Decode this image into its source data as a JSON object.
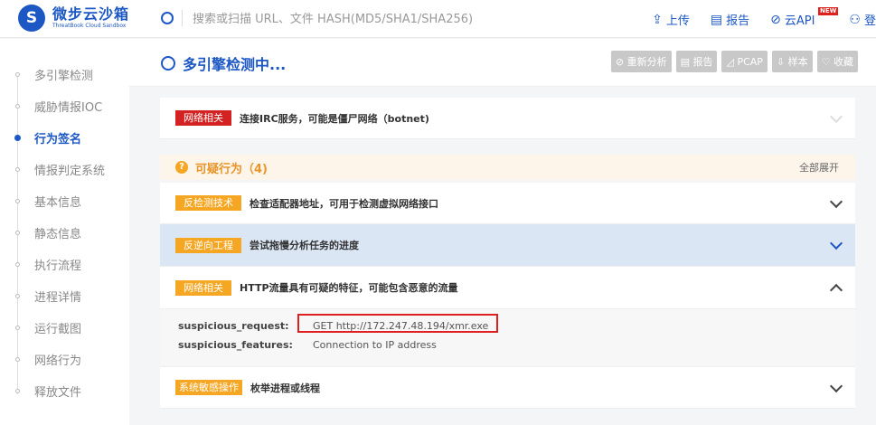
{
  "brand": {
    "title": "微步云沙箱",
    "subtitle": "ThreatBook Cloud Sandbox"
  },
  "search": {
    "placeholder": "搜索或扫描 URL、文件 HASH(MD5/SHA1/SHA256)"
  },
  "top_nav": {
    "upload": "上传",
    "report": "报告",
    "api": "云API",
    "new_badge": "NEW",
    "login": "登"
  },
  "sidebar": {
    "items": [
      {
        "label": "多引擎检测"
      },
      {
        "label": "威胁情报IOC"
      },
      {
        "label": "行为签名",
        "active": true
      },
      {
        "label": "情报判定系统"
      },
      {
        "label": "基本信息"
      },
      {
        "label": "静态信息"
      },
      {
        "label": "执行流程"
      },
      {
        "label": "进程详情"
      },
      {
        "label": "运行截图"
      },
      {
        "label": "网络行为"
      },
      {
        "label": "释放文件"
      }
    ]
  },
  "header": {
    "status": "多引擎检测中...",
    "buttons": {
      "reanalyze": "重新分析",
      "report": "报告",
      "pcap": "PCAP",
      "sample": "样本",
      "favorite": "收藏"
    }
  },
  "signatures": {
    "top_row": {
      "tag": "网络相关",
      "text": "连接IRC服务，可能是僵尸网络（botnet)"
    },
    "suspicious_section": {
      "title": "可疑行为（4)",
      "expand_all": "全部展开"
    },
    "rows": [
      {
        "tag": "反检测技术",
        "text": "检查适配器地址，可用于检测虚拟网络接口"
      },
      {
        "tag": "反逆向工程",
        "text": "尝试拖慢分析任务的进度"
      },
      {
        "tag": "网络相关",
        "text": "HTTP流量具有可疑的特征，可能包含恶意的流量"
      },
      {
        "tag": "系统敏感操作",
        "text": "枚举进程或线程"
      }
    ],
    "detail": {
      "k1": "suspicious_request:",
      "v1": "GET http://172.247.48.194/xmr.exe",
      "k2": "suspicious_features:",
      "v2": "Connection to IP address"
    }
  },
  "colors": {
    "accent": "#1c57c4",
    "danger": "#d42222",
    "warning": "#f5a623",
    "highlight": "#e02020"
  }
}
